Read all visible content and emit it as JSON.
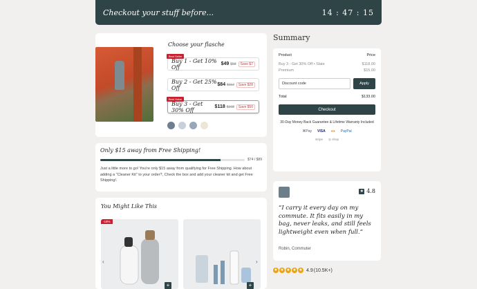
{
  "header": {
    "title": "Checkout your stuff before...",
    "timer": "14 : 47 : 15"
  },
  "product": {
    "choose_label": "Choose your flasche",
    "options": [
      {
        "tag": "Best Seller",
        "label": "Buy 1 - Get 10% Off",
        "price": "$49",
        "old": "$58",
        "save": "Save $7"
      },
      {
        "tag": "",
        "label": "Buy 2 - Get 25% Off",
        "price": "$84",
        "old": "$112",
        "save": "Save $28"
      },
      {
        "tag": "Best Value",
        "label": "Buy 3 - Get 30% Off",
        "price": "$118",
        "old": "$168",
        "save": "Save $50"
      }
    ],
    "swatches": [
      "#6f7f92",
      "#c9d0da",
      "#98a6ba",
      "#ede6d6"
    ]
  },
  "shipping": {
    "heading": "Only $15 away from Free Shipping!",
    "progress_text": "$74 / $89",
    "progress": 0.83,
    "body": "Just a little more to go! You're only $15 away from qualifying for Free Shipping. How about adding a \"Cleaner Kit\" to your order?, Check the box and add your cleaner kit and get Free Shipping!."
  },
  "recommend": {
    "heading": "You Might Like This",
    "badge": "-18%",
    "prev": "‹",
    "next": "›",
    "add": "+"
  },
  "summary": {
    "heading": "Summary",
    "col_product": "Product",
    "col_price": "Price",
    "items": [
      {
        "name": "Buy 3 - Get 30% Off  •  Slate",
        "price": "$118.00"
      },
      {
        "name": "Premium",
        "price": "$15.00"
      }
    ],
    "discount_placeholder": "Discount code",
    "apply_label": "Apply",
    "total_label": "Total",
    "total_value": "$133.00",
    "checkout_label": "Checkout",
    "guarantee": "30-Day Money Back Guarantee & Lifetime Warranty Included",
    "payments": [
      "⌘Pay",
      "VISA",
      "●●",
      "PayPal"
    ],
    "payments2": [
      "stripe",
      "◎ shop"
    ]
  },
  "review": {
    "score": "4.8",
    "quote": "“I carry it every day on my commute.  It fits easily in my bag, never leaks, and still feels lightweight even when full.”",
    "author": "Robin, Commuter"
  },
  "rating": {
    "value": "4.9",
    "count": "(10.5K+)"
  }
}
